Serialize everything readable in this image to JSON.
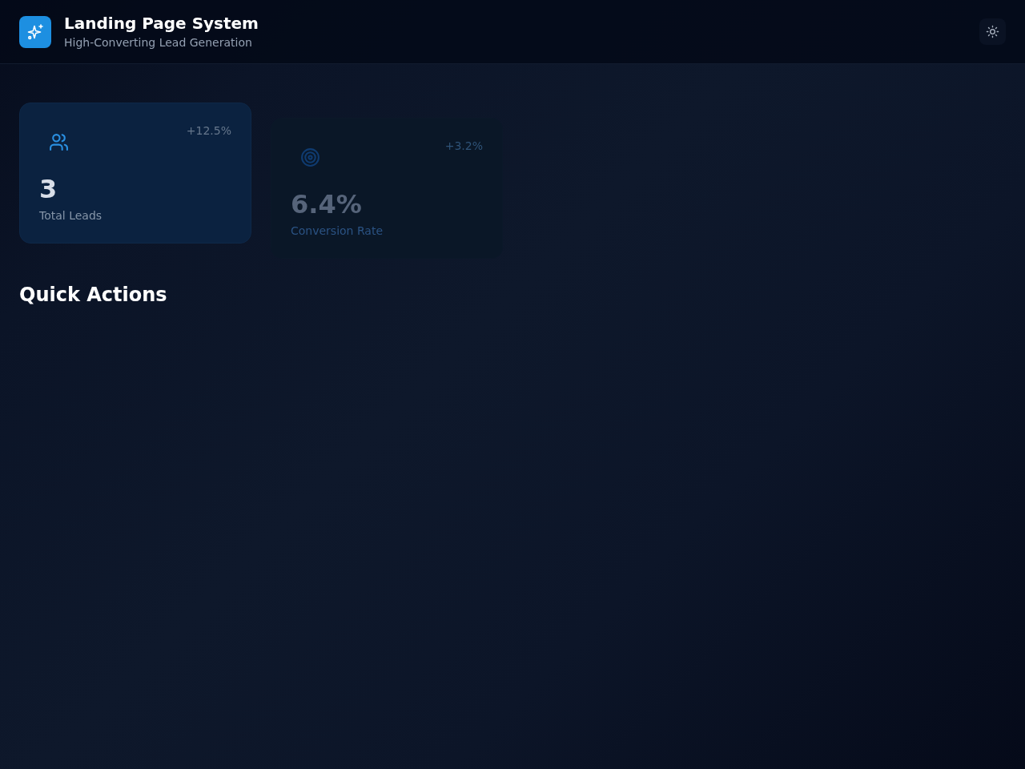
{
  "header": {
    "title": "Landing Page System",
    "subtitle": "High-Converting Lead Generation"
  },
  "stats": [
    {
      "value": "3",
      "label": "Total Leads",
      "change": "+12.5%",
      "dimmed": false
    },
    {
      "value": "6.4%",
      "label": "Conversion Rate",
      "change": "+3.2%",
      "dimmed": true
    }
  ],
  "quick_actions": {
    "title": "Quick Actions"
  }
}
